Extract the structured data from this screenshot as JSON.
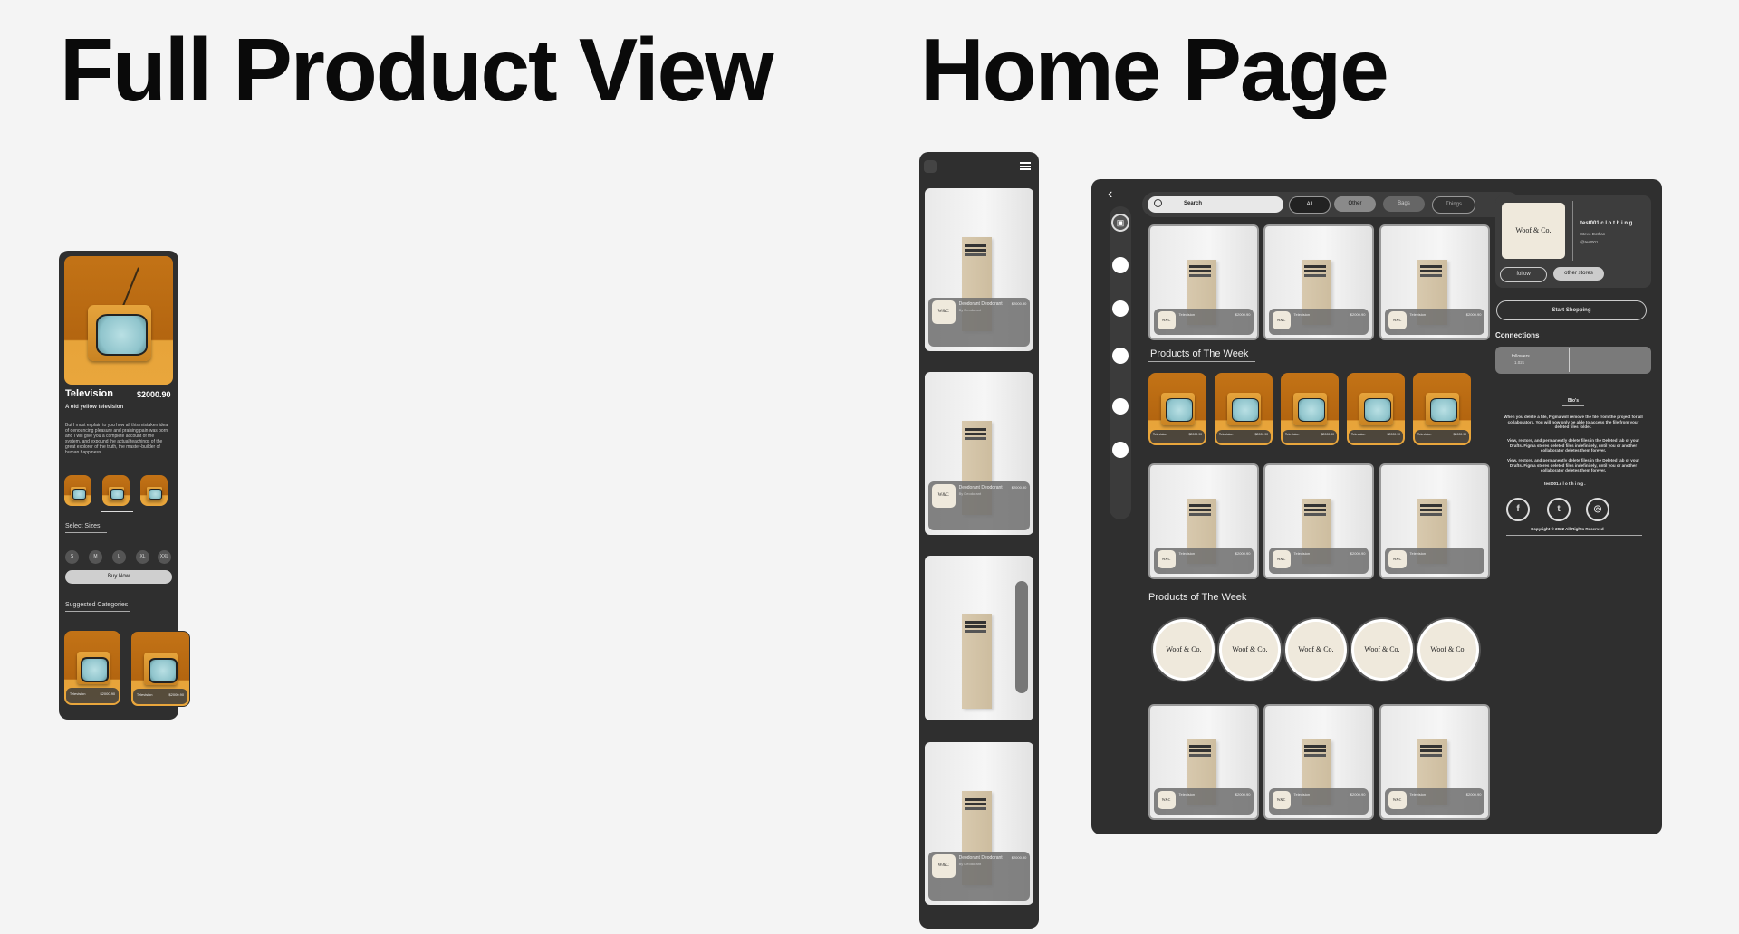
{
  "headings": {
    "left": "Full Product View",
    "right": "Home Page"
  },
  "product_view": {
    "title": "Television",
    "price": "$2000.90",
    "subtitle": "A old yellow television",
    "description": "But I must explain to you how all this mistaken idea of denouncing pleasure and praising pain was born and I will give you a complete account of the system, and expound the actual teachings of the great explorer of the truth, the master-builder of human happiness.",
    "select_sizes_label": "Select Sizes",
    "sizes": [
      "S",
      "M",
      "L",
      "XL",
      "XXL"
    ],
    "buy_button": "Buy Now",
    "suggested_label": "Suggested Categories",
    "suggested_card_title": "Television",
    "suggested_card_price": "$2000.90"
  },
  "home": {
    "search_placeholder": "Search",
    "filters": [
      "All",
      "Other",
      "Bags",
      "Things"
    ],
    "card_title": "Television",
    "card_price": "$2000.90",
    "section_title_1": "Products of The Week",
    "section_title_2": "Products of The Week",
    "store": {
      "logo_text": "Woof & Co.",
      "name": "test001.c l o t h i n g .",
      "location": "Stevo Dothan",
      "handle": "@test001",
      "follow_button": "follow",
      "other_stores_button": "other stores",
      "start_button": "Start Shopping",
      "connections_label": "Connections",
      "followers_label": "followers",
      "followers_count": "1.02k",
      "bio_label": "Bio's",
      "bio_paragraph_1": "When you delete a file, Figma will remove the file from the project for all collaborators. You will now only be able to access the file from your deleted files folder.",
      "bio_paragraph_2": "View, restore, and permanently delete files in the Deleted tab of your Drafts. Figma stores deleted files indefinitely, until you or another collaborator deletes them forever.",
      "bio_paragraph_3": "View, restore, and permanently delete files in the Deleted tab of your Drafts. Figma stores deleted files indefinitely, until you or another collaborator deletes them forever.",
      "footer_name": "test001.c l o t h i n g .",
      "copyright": "Copyright © 2022 All Rights Reserved"
    },
    "mobile_card_title": "Deodorant Deodorant",
    "mobile_card_subtitle": "By Deodorant"
  }
}
